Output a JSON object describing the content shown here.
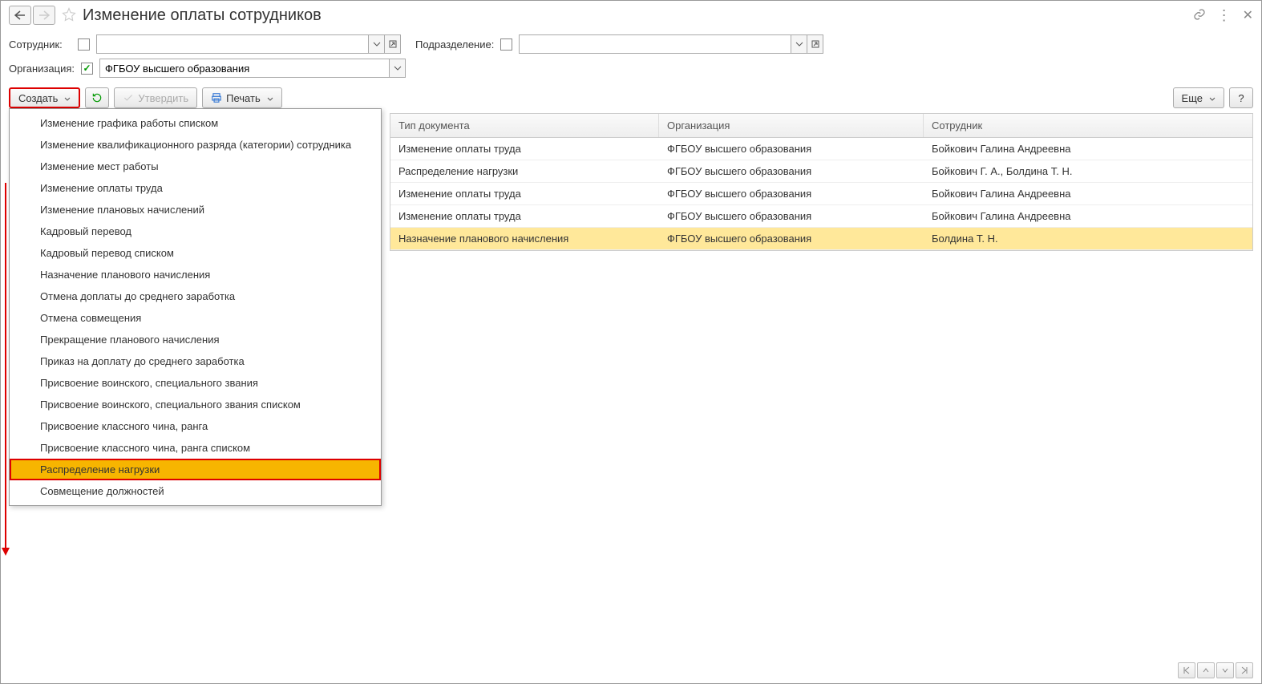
{
  "header": {
    "title": "Изменение оплаты сотрудников"
  },
  "filters": {
    "employee_label": "Сотрудник:",
    "employee_value": "",
    "department_label": "Подразделение:",
    "department_value": "",
    "organization_label": "Организация:",
    "organization_value": "ФГБОУ высшего образования"
  },
  "toolbar": {
    "create_label": "Создать",
    "approve_label": "Утвердить",
    "print_label": "Печать",
    "more_label": "Еще",
    "help_label": "?"
  },
  "dropdown": {
    "items": [
      "Изменение графика работы списком",
      "Изменение квалификационного разряда (категории) сотрудника",
      "Изменение мест работы",
      "Изменение оплаты труда",
      "Изменение плановых начислений",
      "Кадровый перевод",
      "Кадровый перевод списком",
      "Назначение планового начисления",
      "Отмена доплаты до среднего заработка",
      "Отмена совмещения",
      "Прекращение планового начисления",
      "Приказ на доплату до среднего заработка",
      "Присвоение воинского, специального звания",
      "Присвоение воинского, специального звания списком",
      "Присвоение классного чина, ранга",
      "Присвоение классного чина, ранга списком",
      "Распределение нагрузки",
      "Совмещение должностей"
    ],
    "highlighted_index": 16
  },
  "table": {
    "columns": {
      "type": "Тип документа",
      "org": "Организация",
      "emp": "Сотрудник"
    },
    "rows": [
      {
        "type": "Изменение оплаты труда",
        "org": "ФГБОУ высшего образования",
        "emp": "Бойкович Галина Андреевна"
      },
      {
        "type": "Распределение нагрузки",
        "org": "ФГБОУ высшего образования",
        "emp": "Бойкович Г. А., Болдина Т. Н."
      },
      {
        "type": "Изменение оплаты труда",
        "org": "ФГБОУ высшего образования",
        "emp": "Бойкович Галина Андреевна"
      },
      {
        "type": "Изменение оплаты труда",
        "org": "ФГБОУ высшего образования",
        "emp": "Бойкович Галина Андреевна"
      },
      {
        "type": "Назначение планового начисления",
        "org": "ФГБОУ высшего образования",
        "emp": "Болдина Т. Н."
      }
    ],
    "selected_index": 4
  }
}
